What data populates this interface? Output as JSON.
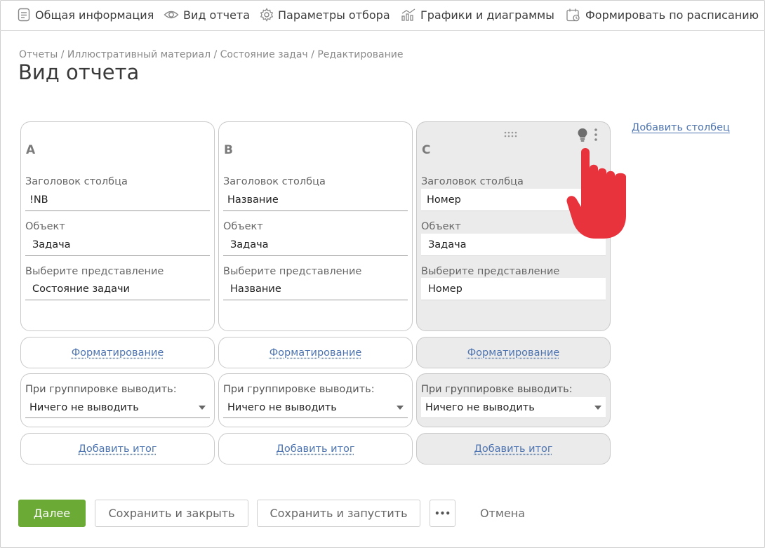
{
  "tabs": [
    {
      "label": "Общая информация",
      "icon": "document-icon"
    },
    {
      "label": "Вид отчета",
      "icon": "eye-icon"
    },
    {
      "label": "Параметры отбора",
      "icon": "gear-icon"
    },
    {
      "label": "Графики и диаграммы",
      "icon": "chart-icon"
    },
    {
      "label": "Формировать по расписанию",
      "icon": "calendar-icon"
    }
  ],
  "breadcrumb": "Отчеты / Иллюстративный материал / Состояние задач / Редактирование",
  "page_title": "Вид отчета",
  "columns": [
    {
      "letter": "A",
      "header_label": "Заголовок столбца",
      "header_value": "!NB",
      "object_label": "Объект",
      "object_value": "Задача",
      "view_label": "Выберите представление",
      "view_value": "Состояние задачи",
      "format_link": "Форматирование",
      "group_label": "При группировке выводить:",
      "group_value": "Ничего не выводить",
      "add_total_link": "Добавить итог"
    },
    {
      "letter": "B",
      "header_label": "Заголовок столбца",
      "header_value": "Название",
      "object_label": "Объект",
      "object_value": "Задача",
      "view_label": "Выберите представление",
      "view_value": "Название",
      "format_link": "Форматирование",
      "group_label": "При группировке выводить:",
      "group_value": "Ничего не выводить",
      "add_total_link": "Добавить итог"
    },
    {
      "letter": "C",
      "header_label": "Заголовок столбца",
      "header_value": "Номер",
      "object_label": "Объект",
      "object_value": "Задача",
      "view_label": "Выберите представление",
      "view_value": "Номер",
      "format_link": "Форматирование",
      "group_label": "При группировке выводить:",
      "group_value": "Ничего не выводить",
      "add_total_link": "Добавить итог"
    }
  ],
  "add_column_link": "Добавить столбец",
  "footer": {
    "next": "Далее",
    "save_close": "Сохранить и закрыть",
    "save_run": "Сохранить и запустить",
    "more": "•••",
    "cancel": "Отмена"
  },
  "colors": {
    "accent_green": "#6aaa35",
    "link_blue": "#4d74b0",
    "pointer_red": "#e8323c"
  }
}
